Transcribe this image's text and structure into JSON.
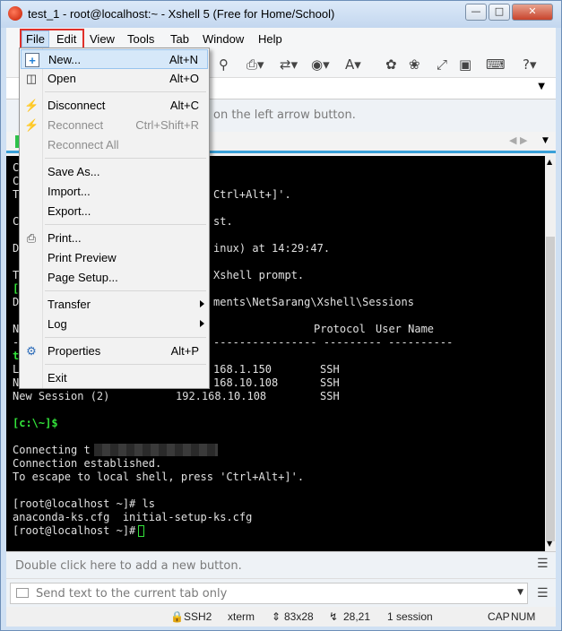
{
  "window": {
    "title": "test_1 - root@localhost:~ - Xshell 5 (Free for Home/School)"
  },
  "menubar": [
    "File",
    "Edit",
    "View",
    "Tools",
    "Tab",
    "Window",
    "Help"
  ],
  "hint": {
    "text": "on the left arrow button."
  },
  "terminal": {
    "line_frag_1": "Ctrl+Alt+]'.",
    "line_frag_2": "st.",
    "line_frag_3": "inux) at 14:29:47.",
    "line_frag_4": "Xshell prompt.",
    "line_frag_5": "ments\\NetSarang\\Xshell\\Sessions",
    "col_protocol": "Protocol",
    "col_user": "User Name",
    "dashes": "---------------- --------- ----------",
    "rows": [
      {
        "host": "168.1.150",
        "protocol": "SSH"
      },
      {
        "host": "168.10.108",
        "protocol": "SSH"
      },
      {
        "name": "New Session (2)",
        "host": "192.168.10.108",
        "protocol": "SSH"
      }
    ],
    "local_prompt": "[c:\\~]$",
    "connecting": "Connecting t",
    "established": "Connection established.",
    "escape": "To escape to local shell, press 'Ctrl+Alt+]'.",
    "cmd_ls": "[root@localhost ~]# ls",
    "ls_output": "anaconda-ks.cfg  initial-setup-ks.cfg",
    "prompt": "[root@localhost ~]#",
    "left_chars": [
      "C",
      "C",
      "T",
      "C",
      "D",
      "T",
      "[",
      "D",
      "N",
      "-",
      "t",
      "L",
      "N"
    ]
  },
  "quickbar": {
    "text": "Double click here to add a new button."
  },
  "sendbar": {
    "placeholder": "Send text to the current tab only"
  },
  "status": {
    "protocol": "SSH2",
    "term": "xterm",
    "size": "83x28",
    "cursor": "28,21",
    "sessions": "1 session",
    "cap": "CAP",
    "num": "NUM"
  },
  "file_menu": {
    "new": {
      "label": "New...",
      "shortcut": "Alt+N"
    },
    "open": {
      "label": "Open",
      "shortcut": "Alt+O"
    },
    "disconnect": {
      "label": "Disconnect",
      "shortcut": "Alt+C"
    },
    "reconnect": {
      "label": "Reconnect",
      "shortcut": "Ctrl+Shift+R"
    },
    "reconnect_all": {
      "label": "Reconnect All"
    },
    "save_as": {
      "label": "Save As..."
    },
    "import": {
      "label": "Import..."
    },
    "export": {
      "label": "Export..."
    },
    "print": {
      "label": "Print..."
    },
    "print_preview": {
      "label": "Print Preview"
    },
    "page_setup": {
      "label": "Page Setup..."
    },
    "transfer": {
      "label": "Transfer"
    },
    "log": {
      "label": "Log"
    },
    "properties": {
      "label": "Properties",
      "shortcut": "Alt+P"
    },
    "exit": {
      "label": "Exit"
    }
  },
  "colors": {
    "highlight_box": "#e0302a",
    "tab_accent": "#3aa0d8",
    "terminal_green": "#33e23a"
  }
}
